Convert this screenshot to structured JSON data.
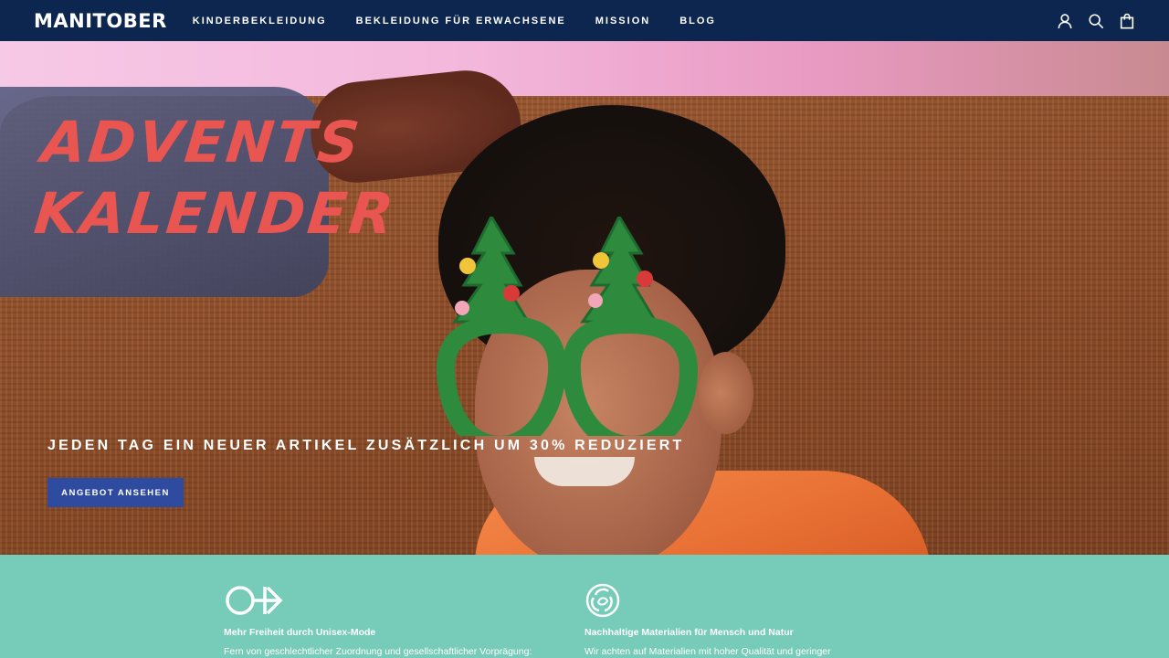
{
  "header": {
    "logo": "MANITOBER",
    "nav": [
      "KINDERBEKLEIDUNG",
      "BEKLEIDUNG FÜR ERWACHSENE",
      "MISSION",
      "BLOG"
    ],
    "icons": [
      "account-icon",
      "search-icon",
      "shopping-bag-icon"
    ]
  },
  "hero": {
    "title_line1": "Advents",
    "title_line2": "Kalender",
    "subtitle": "JEDEN TAG EIN NEUER ARTIKEL ZUSÄTZLICH UM 30% REDUZIERT",
    "cta": "ANGEBOT ANSEHEN",
    "colors": {
      "title": "#e95550",
      "cta_bg": "#2f4ba0"
    }
  },
  "features": [
    {
      "icon": "unisex-icon",
      "title": "Mehr Freiheit durch Unisex-Mode",
      "text": "Fern von geschlechtlicher Zuordnung und gesellschaftlicher Vorprägung:"
    },
    {
      "icon": "recycle-leaf-icon",
      "title": "Nachhaltige Materialien für Mensch und Natur",
      "text": "Wir achten auf Materialien mit hoher Qualität und geringer"
    }
  ],
  "colors": {
    "header_bg": "#0d2650",
    "features_bg": "#76ccb9"
  }
}
